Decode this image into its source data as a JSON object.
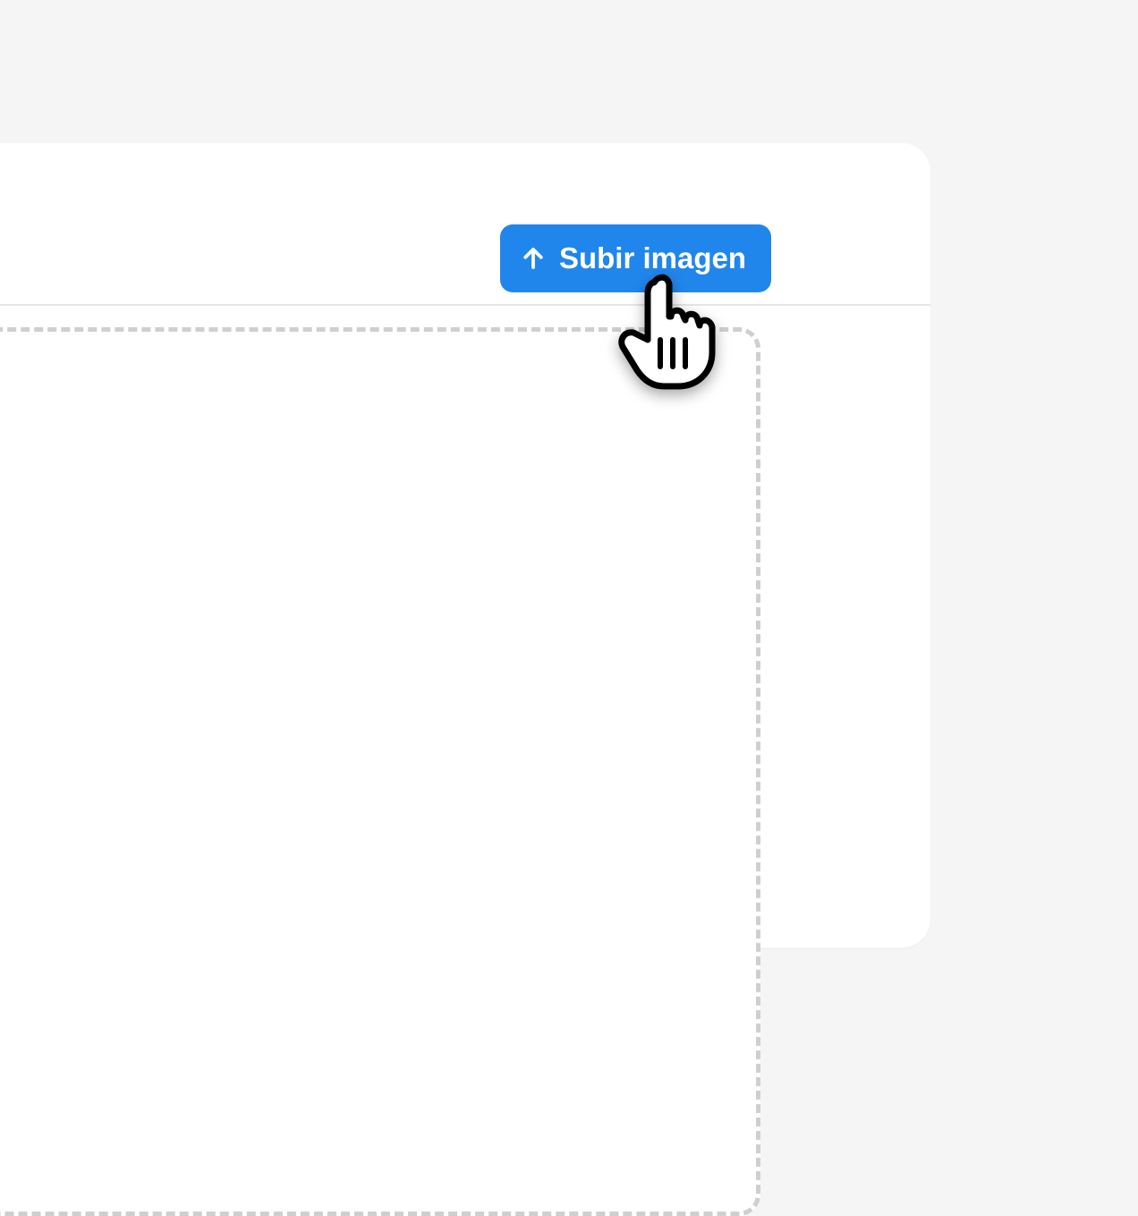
{
  "upload": {
    "button_label": "Subir imagen"
  }
}
